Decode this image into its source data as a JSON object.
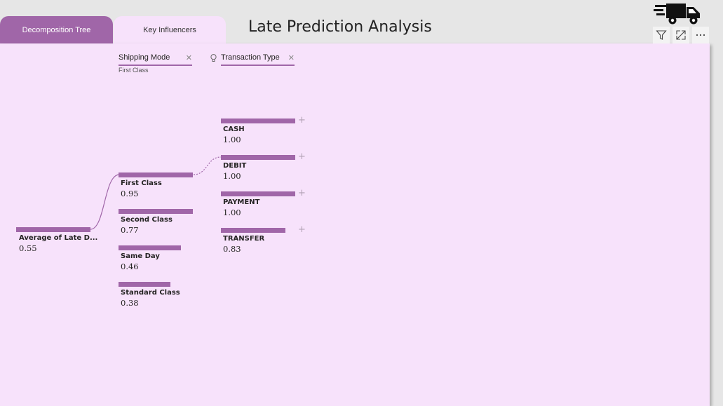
{
  "tabs": [
    {
      "label": "Decomposition Tree"
    },
    {
      "label": "Key Influencers"
    }
  ],
  "report_title": "Late Prediction Analysis",
  "icons": {
    "logo": "delivery-truck-icon",
    "filter": "filter-icon",
    "focus": "focus-mode-icon",
    "more": "more-options-icon",
    "ai_split": "lightbulb-icon",
    "remove": "close-icon",
    "expand": "plus-icon"
  },
  "colors": {
    "accent": "#a066a8",
    "canvas": "#f7e2fb",
    "background": "#e6e6e6"
  },
  "tree": {
    "levels": [
      {
        "field": "Shipping Mode",
        "selected": "First Class"
      },
      {
        "field": "Transaction Type",
        "selected": ""
      }
    ],
    "root": {
      "label": "Average of Late D...",
      "value": "0.55"
    },
    "shipping_modes": [
      {
        "label": "First Class",
        "value": "0.95"
      },
      {
        "label": "Second Class",
        "value": "0.77"
      },
      {
        "label": "Same Day",
        "value": "0.46"
      },
      {
        "label": "Standard Class",
        "value": "0.38"
      }
    ],
    "transaction_types": [
      {
        "label": "CASH",
        "value": "1.00"
      },
      {
        "label": "DEBIT",
        "value": "1.00"
      },
      {
        "label": "PAYMENT",
        "value": "1.00"
      },
      {
        "label": "TRANSFER",
        "value": "0.83"
      }
    ]
  }
}
